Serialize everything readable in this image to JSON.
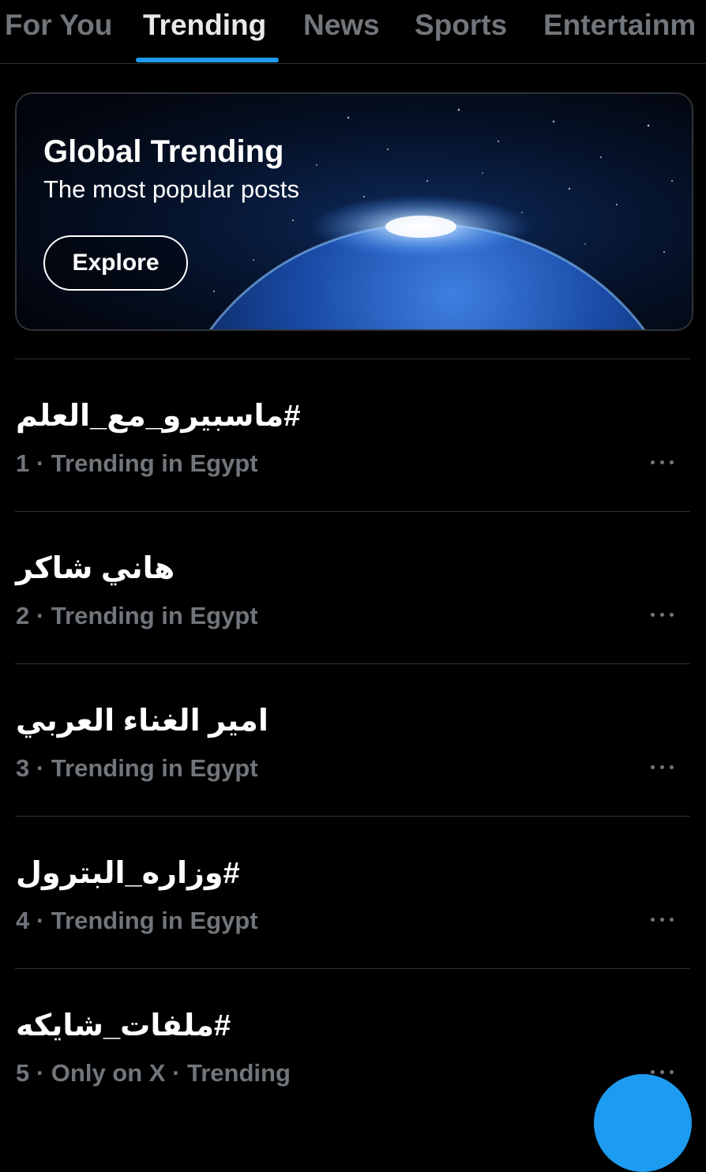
{
  "tabs": [
    {
      "label": "For You",
      "active": false
    },
    {
      "label": "Trending",
      "active": true
    },
    {
      "label": "News",
      "active": false
    },
    {
      "label": "Sports",
      "active": false
    },
    {
      "label": "Entertainm",
      "active": false
    }
  ],
  "banner": {
    "title": "Global Trending",
    "subtitle": "The most popular posts",
    "button_label": "Explore",
    "image": "earth-from-space"
  },
  "trends": [
    {
      "rank": "1",
      "title": "#ماسبيرو_مع_العلم",
      "meta": "1 · Trending in Egypt",
      "more_icon": "more-horizontal-icon"
    },
    {
      "rank": "2",
      "title": "هاني شاكر",
      "meta": "2 · Trending in Egypt",
      "more_icon": "more-horizontal-icon"
    },
    {
      "rank": "3",
      "title": "امير الغناء العربي",
      "meta": "3 · Trending in Egypt",
      "more_icon": "more-horizontal-icon"
    },
    {
      "rank": "4",
      "title": "#وزاره_البترول",
      "meta": "4 · Trending in Egypt",
      "more_icon": "more-horizontal-icon"
    },
    {
      "rank": "5",
      "title": "#ملفات_شايكه",
      "meta": "5 · Only on X · Trending",
      "more_icon": "more-horizontal-icon"
    }
  ],
  "colors": {
    "background": "#000000",
    "accent": "#1d9bf0",
    "text_primary": "#e7e9ea",
    "text_secondary": "#71767b",
    "divider": "#2f3336"
  },
  "fab": {
    "icon": "compose-icon"
  }
}
